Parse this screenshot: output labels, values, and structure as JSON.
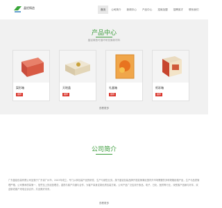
{
  "header": {
    "logo_text": "晶铝铸造",
    "nav": [
      "首页",
      "公司简介",
      "新闻中心",
      "产品中心",
      "招商加盟",
      "招聘英才",
      "联系我们"
    ],
    "active_index": 0
  },
  "products": {
    "title": "产品中心",
    "subtitle": "晶铝铸造可循环研发最新材料",
    "items": [
      {
        "name": "梨形箱",
        "tag": "推荐"
      },
      {
        "name": "天地盖",
        "tag": "推荐"
      },
      {
        "name": "礼盒箱",
        "tag": "推荐"
      },
      {
        "name": "纸彩箱",
        "tag": "推荐"
      }
    ],
    "more_label": "查看更多"
  },
  "about": {
    "title": "公司简介",
    "text": "广东晶铝包装有限公司坐落于广东省广州市，2003年成立，专门从事包装产品的研发、生产与销售业务。旗下晶铝包装品牌开发能够满足国内外市场需要的多种规格纸箱产品，生产与品质管理严格，公司秉承质量第一、信誉至上的经营理念，重视与客户沟通与合作，为客户量身定制优质包装方案。公司产品广泛应用于食品、电子、日化、医药等行业，深受客户信赖与好评，欢迎新老客户来电洽谈合作，共创美好未来。",
    "more_label": "查看更多"
  },
  "colors": {
    "accent": "#3b9c3b",
    "tag": "#d9342b",
    "hero_bg": "#f1f1f1"
  }
}
